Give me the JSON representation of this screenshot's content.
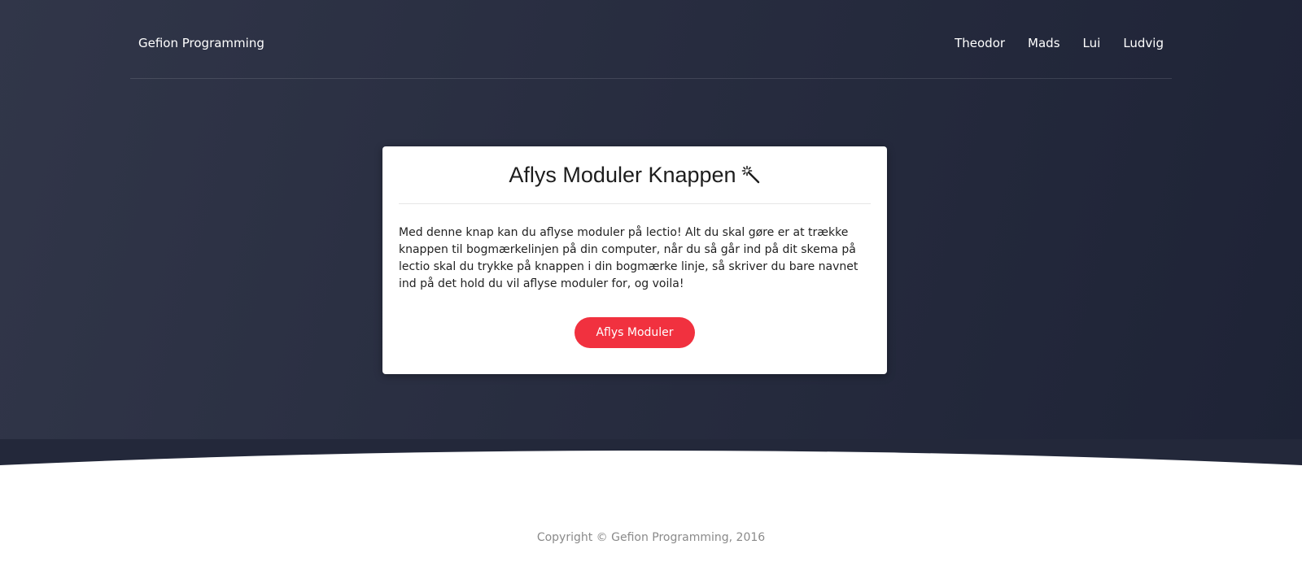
{
  "header": {
    "brand": "Gefion Programming",
    "nav": [
      "Theodor",
      "Mads",
      "Lui",
      "Ludvig"
    ]
  },
  "card": {
    "title": "Aflys Moduler Knappen",
    "title_icon": "magic-wand-icon",
    "body": "Med denne knap kan du aflyse moduler på lectio! Alt du skal gøre er at trække knappen til bogmærkelinjen på din computer, når du så går ind på dit skema på lectio skal du trykke på knappen i din bogmærke linje, så skriver du bare navnet ind på det hold du vil aflyse moduler for, og voila!",
    "button_label": "Aflys Moduler"
  },
  "footer": {
    "copyright": "Copyright © Gefion Programming, 2016"
  },
  "colors": {
    "hero_start": "#313649",
    "hero_end": "#1e2336",
    "accent": "#f1313f"
  }
}
